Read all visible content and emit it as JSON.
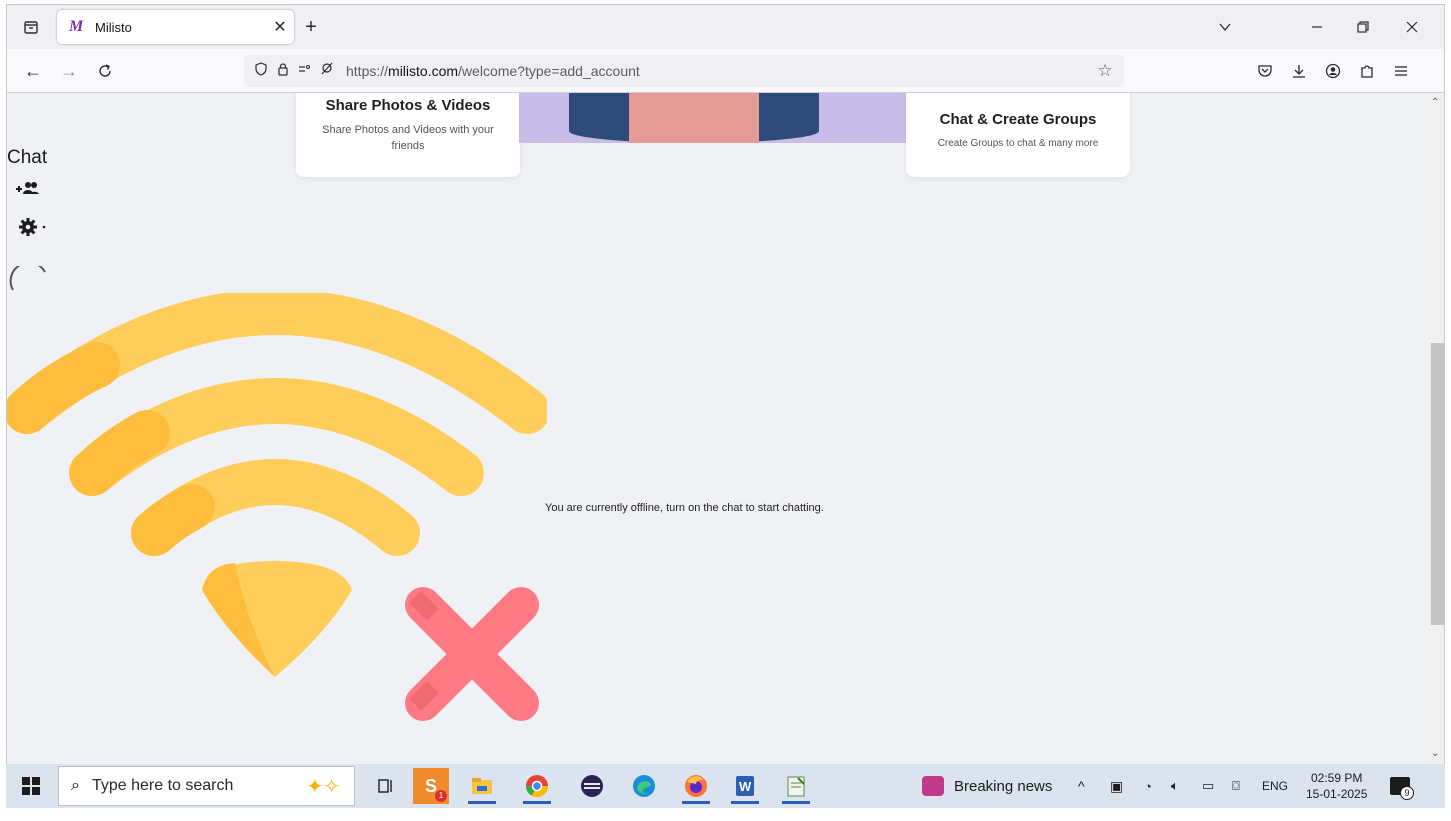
{
  "browser": {
    "tab_title": "Milisto",
    "tab_favicon": "M",
    "url_prefix": "https://",
    "url_domain": "milisto.com",
    "url_path": "/welcome?type=add_account"
  },
  "page": {
    "cards": [
      {
        "title": "Share Photos & Videos",
        "desc": "Share Photos and Videos with your friends"
      },
      {
        "title": "Chat & Create Groups",
        "desc": "Create Groups to chat & many more"
      }
    ],
    "chat_label": "Chat",
    "offline_message": "You are currently offline, turn on the chat to start chatting."
  },
  "taskbar": {
    "search_placeholder": "Type here to search",
    "news_label": "Breaking news",
    "lang": "ENG",
    "time": "02:59 PM",
    "date": "15-01-2025",
    "notification_count": "9",
    "skype_badge": "1"
  },
  "colors": {
    "wifi": "#ffcd5a",
    "wifi_shade": "#ffbd3e",
    "cross": "#ff7a84",
    "cross_shade": "#f06a75",
    "accent": "#7b2ea8"
  }
}
